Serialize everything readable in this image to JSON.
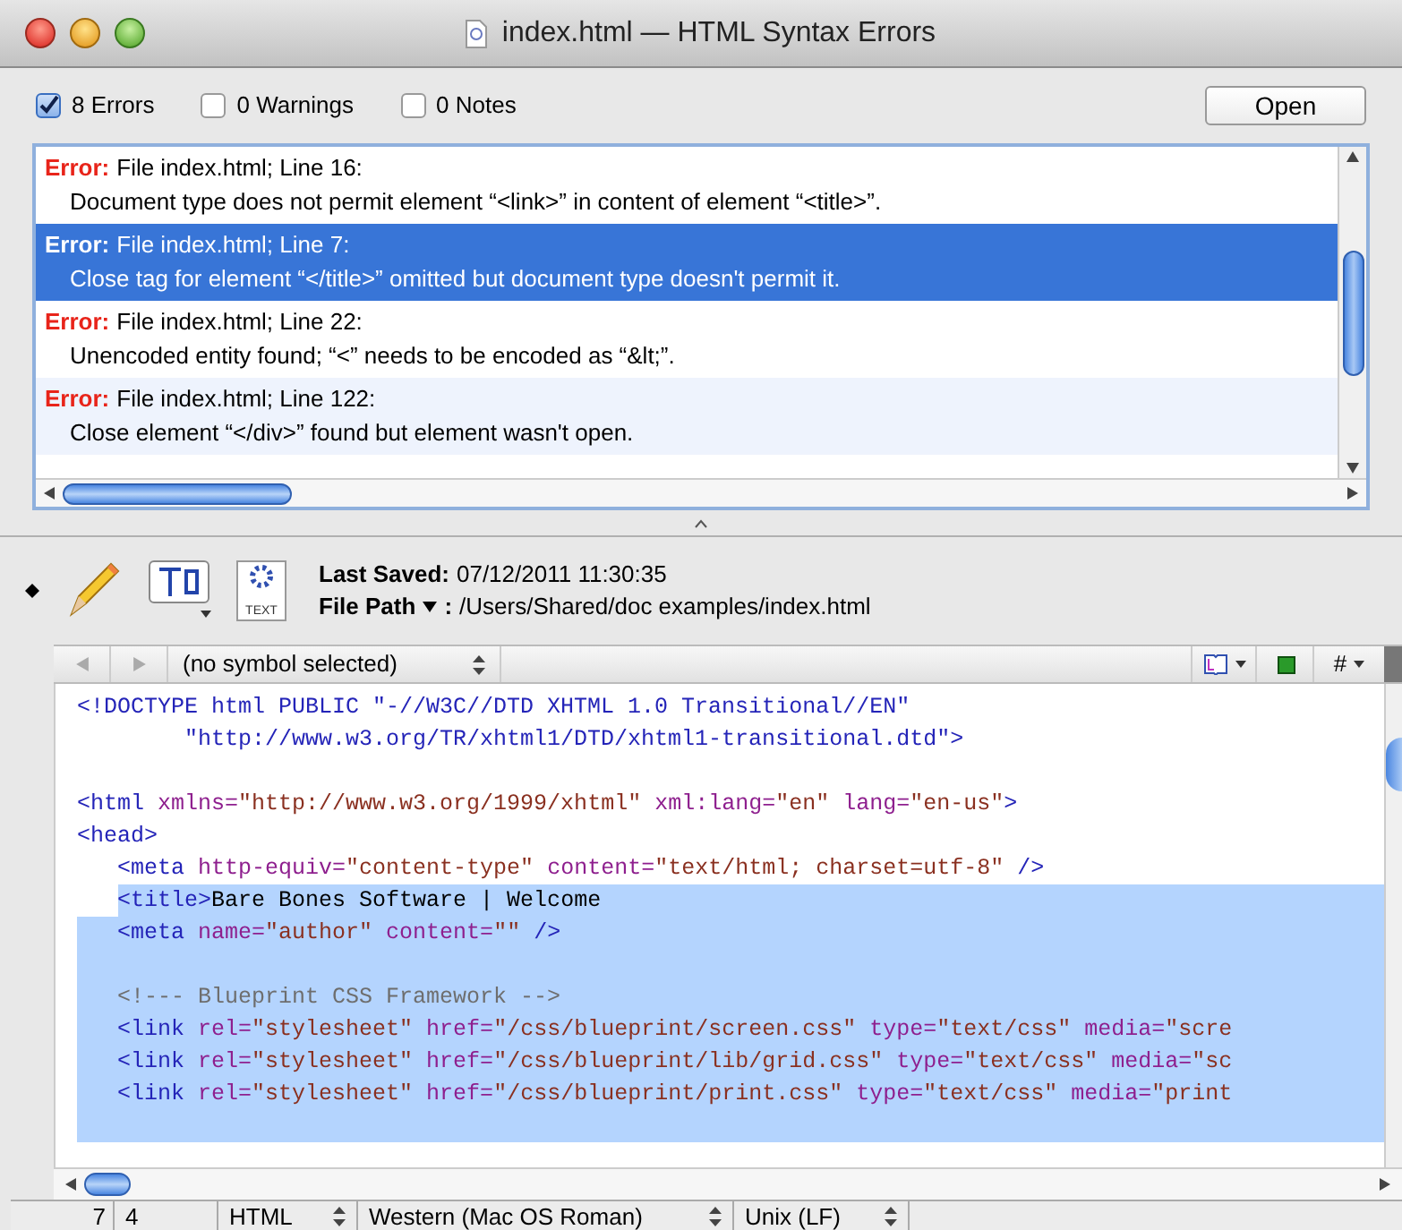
{
  "window": {
    "title": "index.html — HTML Syntax Errors"
  },
  "filters": [
    {
      "label": "8 Errors",
      "checked": true
    },
    {
      "label": "0 Warnings",
      "checked": false
    },
    {
      "label": "0 Notes",
      "checked": false
    }
  ],
  "open_button": "Open",
  "errors": [
    {
      "label": "Error:",
      "location": "File index.html; Line 16:",
      "message": "Document type does not permit element “<link>” in content of element “<title>”.",
      "selected": false
    },
    {
      "label": "Error:",
      "location": "File index.html; Line 7:",
      "message": "Close tag for element “</title>” omitted but document type doesn't permit it.",
      "selected": true
    },
    {
      "label": "Error:",
      "location": "File index.html; Line 22:",
      "message": "Unencoded entity found; “<” needs to be encoded as “&lt;”.",
      "selected": false
    },
    {
      "label": "Error:",
      "location": "File index.html; Line 122:",
      "message": "Close element “</div>” found but element wasn't open.",
      "selected": false
    }
  ],
  "info": {
    "last_saved_label": "Last Saved:",
    "last_saved": "07/12/2011 11:30:35",
    "file_path_label": "File Path",
    "file_path_sep": ":",
    "file_path": "/Users/Shared/doc examples/index.html",
    "doc_icon_label": "TEXT"
  },
  "navigator": {
    "symbol": "(no symbol selected)",
    "hash": "#"
  },
  "code": [
    {
      "selected": false,
      "tokens": [
        {
          "kind": "tag",
          "text": "<!DOCTYPE html PUBLIC \"-//W3C//DTD XHTML 1.0 Transitional//EN\""
        }
      ]
    },
    {
      "selected": false,
      "tokens": [
        {
          "kind": "tag",
          "text": "        \"http://www.w3.org/TR/xhtml1/DTD/xhtml1-transitional.dtd\">"
        }
      ]
    },
    {
      "selected": false
    },
    {
      "selected": false,
      "tokens": [
        {
          "kind": "tag",
          "text": "<html"
        },
        {
          "kind": "attr",
          "text": " xmlns="
        },
        {
          "kind": "value",
          "text": "\"http://www.w3.org/1999/xhtml\""
        },
        {
          "kind": "attr",
          "text": " xml:lang="
        },
        {
          "kind": "value",
          "text": "\"en\""
        },
        {
          "kind": "attr",
          "text": " lang="
        },
        {
          "kind": "value",
          "text": "\"en-us\""
        },
        {
          "kind": "tag",
          "text": ">"
        }
      ]
    },
    {
      "selected": false,
      "tokens": [
        {
          "kind": "tag",
          "text": "<head>"
        }
      ]
    },
    {
      "selected": false,
      "tokens": [
        {
          "kind": "tag",
          "text": "   <meta"
        },
        {
          "kind": "attr",
          "text": " http-equiv="
        },
        {
          "kind": "value",
          "text": "\"content-type\""
        },
        {
          "kind": "attr",
          "text": " content="
        },
        {
          "kind": "value",
          "text": "\"text/html; charset=utf-8\""
        },
        {
          "kind": "tag",
          "text": " />"
        }
      ]
    },
    {
      "selected": true,
      "tokens": [
        {
          "kind": "tag",
          "text": "   <title>"
        },
        {
          "kind": "text",
          "text": "Bare Bones Software | Welcome"
        }
      ]
    },
    {
      "selected": true,
      "tokens": [
        {
          "kind": "tag",
          "text": "   <meta"
        },
        {
          "kind": "attr",
          "text": " name="
        },
        {
          "kind": "value",
          "text": "\"author\""
        },
        {
          "kind": "attr",
          "text": " content="
        },
        {
          "kind": "value",
          "text": "\"\""
        },
        {
          "kind": "tag",
          "text": " />"
        }
      ]
    },
    {
      "selected": true
    },
    {
      "selected": true,
      "tokens": [
        {
          "kind": "comment",
          "text": "   <!--- Blueprint CSS Framework -->"
        }
      ]
    },
    {
      "selected": true,
      "tokens": [
        {
          "kind": "tag",
          "text": "   <link"
        },
        {
          "kind": "attr",
          "text": " rel="
        },
        {
          "kind": "value",
          "text": "\"stylesheet\""
        },
        {
          "kind": "attr",
          "text": " href="
        },
        {
          "kind": "value",
          "text": "\"/css/blueprint/screen.css\""
        },
        {
          "kind": "attr",
          "text": " type="
        },
        {
          "kind": "value",
          "text": "\"text/css\""
        },
        {
          "kind": "attr",
          "text": " media="
        },
        {
          "kind": "value",
          "text": "\"scre"
        }
      ]
    },
    {
      "selected": true,
      "tokens": [
        {
          "kind": "tag",
          "text": "   <link"
        },
        {
          "kind": "attr",
          "text": " rel="
        },
        {
          "kind": "value",
          "text": "\"stylesheet\""
        },
        {
          "kind": "attr",
          "text": " href="
        },
        {
          "kind": "value",
          "text": "\"/css/blueprint/lib/grid.css\""
        },
        {
          "kind": "attr",
          "text": " type="
        },
        {
          "kind": "value",
          "text": "\"text/css\""
        },
        {
          "kind": "attr",
          "text": " media="
        },
        {
          "kind": "value",
          "text": "\"sc"
        }
      ]
    },
    {
      "selected": true,
      "tokens": [
        {
          "kind": "tag",
          "text": "   <link"
        },
        {
          "kind": "attr",
          "text": " rel="
        },
        {
          "kind": "value",
          "text": "\"stylesheet\""
        },
        {
          "kind": "attr",
          "text": " href="
        },
        {
          "kind": "value",
          "text": "\"/css/blueprint/print.css\""
        },
        {
          "kind": "attr",
          "text": " type="
        },
        {
          "kind": "value",
          "text": "\"text/css\""
        },
        {
          "kind": "attr",
          "text": " media="
        },
        {
          "kind": "value",
          "text": "\"print"
        }
      ]
    },
    {
      "selected": true
    }
  ],
  "status_bar": {
    "line": "7",
    "column": "4",
    "language": "HTML",
    "encoding": "Western (Mac OS Roman)",
    "line_endings": "Unix (LF)"
  }
}
